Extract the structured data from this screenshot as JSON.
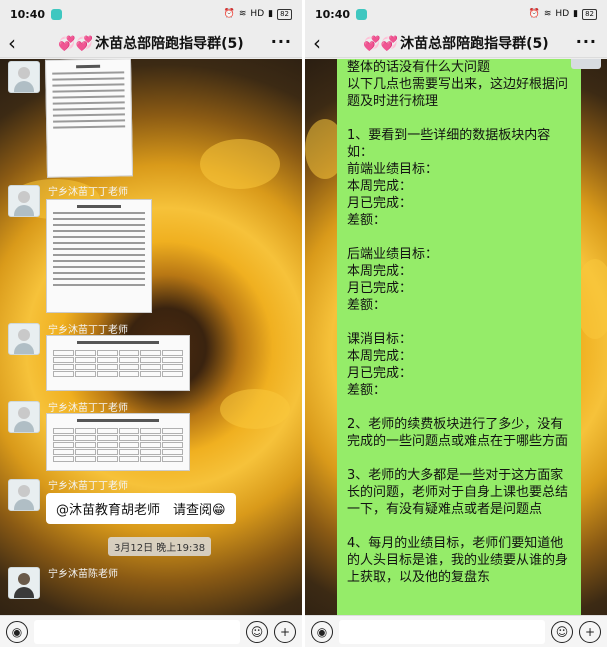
{
  "status": {
    "time": "10:40",
    "network": "HD",
    "battery": "82"
  },
  "chat": {
    "title": "沐苗总部陪跑指导群(5)",
    "title_hearts": "💞💞"
  },
  "left": {
    "senders": [
      "宁乡沐苗丁丁老师",
      "宁乡沐苗丁丁老师",
      "宁乡沐苗丁丁老师",
      "宁乡沐苗丁丁老师",
      "宁乡沐苗陈老师"
    ],
    "mention_message": "@沐苗教育胡老师　请查阅😁",
    "timestamp": "3月12日 晚上19:38"
  },
  "right": {
    "message": "整体的话没有什么大问题\n以下几点也需要写出来，这边好根据问题及时进行梳理\n\n1、要看到一些详细的数据板块内容\n如：\n前端业绩目标：\n本周完成：\n月已完成：\n差额：\n\n后端业绩目标：\n本周完成：\n月已完成：\n差额：\n\n课消目标：\n本周完成：\n月已完成：\n差额：\n\n2、老师的续费板块进行了多少，没有完成的一些问题点或难点在于哪些方面\n\n3、老师的大多都是一些对于这方面家长的问题，老师对于自身上课也要总结一下，有没有疑难点或者是问题点\n\n4、每月的业绩目标，老师们要知道他的人头目标是谁，我的业绩要从谁的身上获取，以及他的复盘东"
  },
  "icons": {
    "back": "‹",
    "more": "···",
    "voice": "◉",
    "emoji": "☺",
    "plus": "+"
  }
}
